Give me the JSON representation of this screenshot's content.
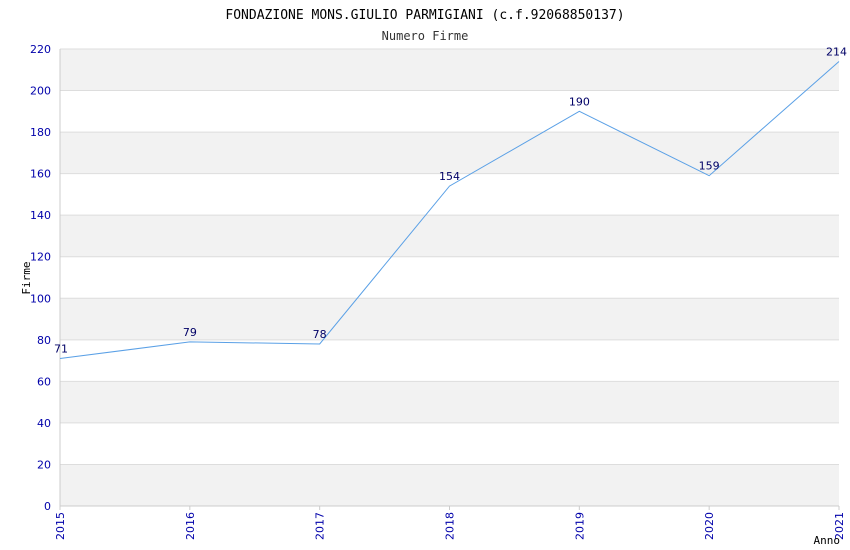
{
  "chart_data": {
    "type": "line",
    "title": "FONDAZIONE MONS.GIULIO PARMIGIANI (c.f.92068850137)",
    "subtitle": "Numero Firme",
    "xlabel": "Anno",
    "ylabel": "Firme",
    "x": [
      "2015",
      "2016",
      "2017",
      "2018",
      "2019",
      "2020",
      "2021"
    ],
    "values": [
      71,
      79,
      78,
      154,
      190,
      159,
      214
    ],
    "data_labels": [
      "71",
      "79",
      "78",
      "154",
      "190",
      "159",
      "214"
    ],
    "ylim": [
      0,
      220
    ],
    "yticks": [
      "0",
      "20",
      "40",
      "60",
      "80",
      "100",
      "120",
      "140",
      "160",
      "180",
      "200",
      "220"
    ],
    "grid": "horizontal bands",
    "colors": {
      "line": "#5aa0e6",
      "band": "#f2f2f2",
      "tick_text": "#0000aa",
      "data_label": "#000066"
    }
  }
}
